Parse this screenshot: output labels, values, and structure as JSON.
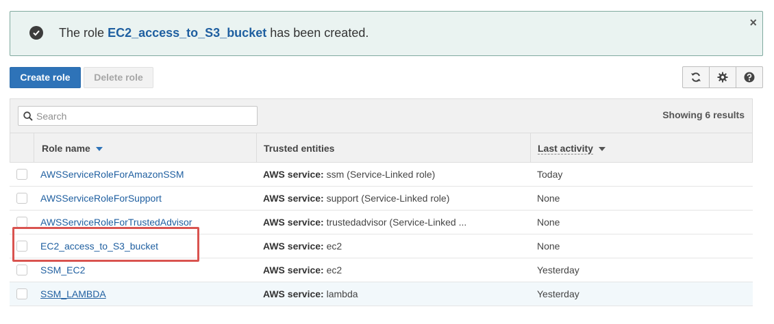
{
  "banner": {
    "prefix": "The role",
    "role_name": "EC2_access_to_S3_bucket",
    "suffix": "has been created.",
    "close_symbol": "×",
    "icon": "check-circle-icon"
  },
  "toolbar": {
    "create_label": "Create role",
    "delete_label": "Delete role",
    "icons": [
      "refresh-icon",
      "gear-icon",
      "help-icon"
    ]
  },
  "search": {
    "placeholder": "Search",
    "value": "",
    "results_text": "Showing 6 results"
  },
  "table": {
    "columns": {
      "role_name": "Role name",
      "trusted_entities": "Trusted entities",
      "last_activity": "Last activity"
    },
    "rows": [
      {
        "name": "AWSServiceRoleForAmazonSSM",
        "trust_label": "AWS service:",
        "trust_value": "ssm (Service-Linked role)",
        "activity": "Today"
      },
      {
        "name": "AWSServiceRoleForSupport",
        "trust_label": "AWS service:",
        "trust_value": "support (Service-Linked role)",
        "activity": "None"
      },
      {
        "name": "AWSServiceRoleForTrustedAdvisor",
        "trust_label": "AWS service:",
        "trust_value": "trustedadvisor (Service-Linked ...",
        "activity": "None"
      },
      {
        "name": "EC2_access_to_S3_bucket",
        "trust_label": "AWS service:",
        "trust_value": "ec2",
        "activity": "None"
      },
      {
        "name": "SSM_EC2",
        "trust_label": "AWS service:",
        "trust_value": "ec2",
        "activity": "Yesterday"
      },
      {
        "name": "SSM_LAMBDA",
        "trust_label": "AWS service:",
        "trust_value": "lambda",
        "activity": "Yesterday"
      }
    ]
  },
  "colors": {
    "primary": "#2e73b8",
    "link": "#1f5fa0",
    "banner_bg": "#eaf3f1",
    "highlight": "#d9534f"
  }
}
